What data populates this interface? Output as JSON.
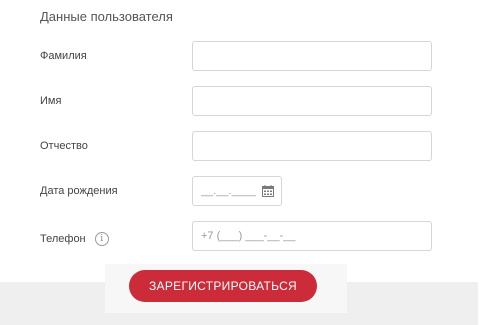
{
  "section": {
    "title": "Данные пользователя"
  },
  "fields": {
    "last_name": {
      "label": "Фамилия",
      "value": "",
      "placeholder": ""
    },
    "first_name": {
      "label": "Имя",
      "value": "",
      "placeholder": ""
    },
    "middle_name": {
      "label": "Отчество",
      "value": "",
      "placeholder": ""
    },
    "birth_date": {
      "label": "Дата рождения",
      "value": "",
      "placeholder": "__.__.____"
    },
    "phone": {
      "label": "Телефон",
      "value": "",
      "placeholder": "+7 (___) ___-__-__"
    }
  },
  "info_icon_glyph": "i",
  "icons": {
    "calendar": "calendar-icon",
    "info": "info-icon"
  },
  "actions": {
    "register_label": "ЗАРЕГИСТРИРОВАТЬСЯ"
  },
  "colors": {
    "accent": "#cc2b3a",
    "field_border": "#d6d6d6",
    "band": "#efefef"
  }
}
